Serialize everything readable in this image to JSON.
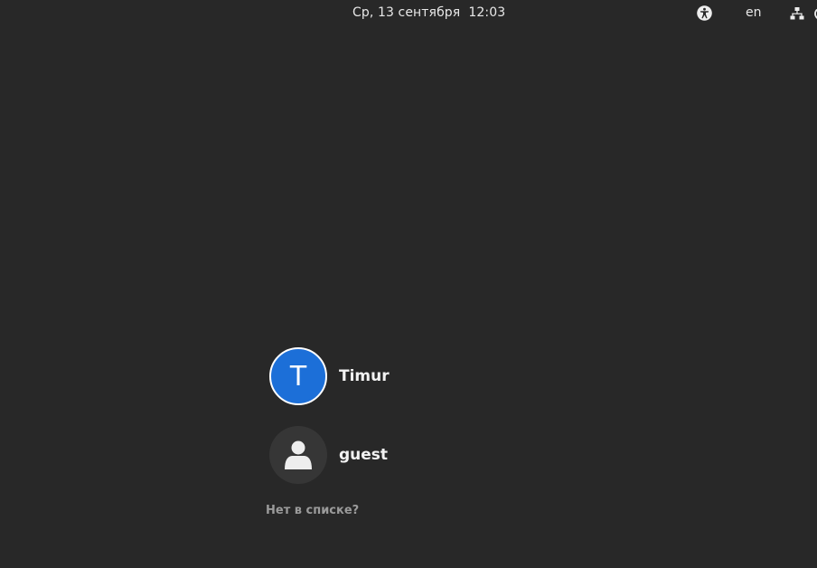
{
  "topbar": {
    "clock": "Ср, 13 сентября  12:03",
    "language": "en",
    "icons": [
      "accessibility-icon",
      "network-wired-icon",
      "power-icon"
    ]
  },
  "users": [
    {
      "name": "Timur",
      "avatar_initial": "T",
      "avatar_color": "#1c6fd8"
    },
    {
      "name": "guest",
      "avatar_icon": "person-icon"
    }
  ],
  "not_listed_label": "Нет в списке?",
  "colors": {
    "background": "#282828",
    "accent": "#1c6fd8",
    "muted_text": "#9b9b9b"
  }
}
